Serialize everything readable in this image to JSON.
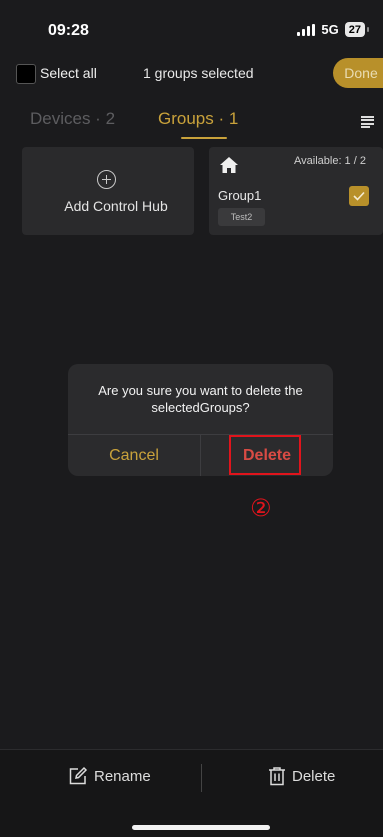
{
  "status_bar": {
    "time": "09:28",
    "network": "5G",
    "battery": "27"
  },
  "selection_bar": {
    "select_all_label": "Select all",
    "selected_count": "1 groups selected",
    "done_label": "Done"
  },
  "tabs": [
    {
      "label": "Devices · 2",
      "active": false
    },
    {
      "label": "Groups · 1",
      "active": true
    }
  ],
  "add_card": {
    "label": "Add Control Hub"
  },
  "group_card": {
    "icon": "home-icon",
    "available": "Available: 1 / 2",
    "name": "Group1",
    "tag": "Test2",
    "checked": true
  },
  "dialog": {
    "message": "Are you sure you want to delete the selectedGroups?",
    "cancel_label": "Cancel",
    "delete_label": "Delete"
  },
  "annotation": {
    "step_marker": "②"
  },
  "bottom_bar": {
    "rename_label": "Rename",
    "delete_label": "Delete"
  },
  "colors": {
    "accent": "#c9a23b",
    "danger": "#d84b44",
    "annotation": "#e0141c",
    "background": "#1b1b1d"
  }
}
